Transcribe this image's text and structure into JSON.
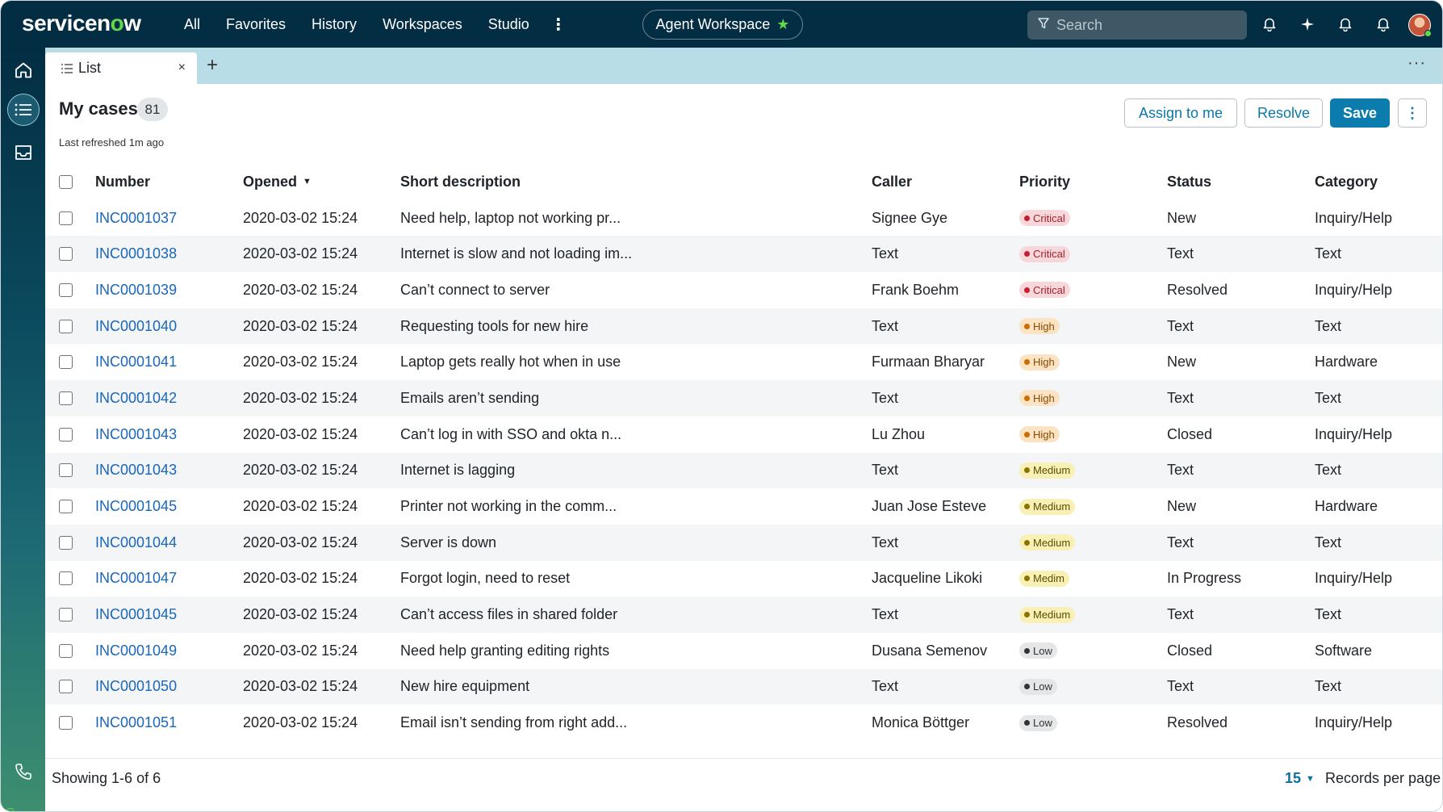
{
  "colors": {
    "nav_bg": "#032d42",
    "accent": "#0b7cad",
    "link": "#1a66b8",
    "brand_green": "#62d84e",
    "tab_bar": "#b9dde6"
  },
  "nav": {
    "logo_prefix": "servicen",
    "logo_o": "o",
    "logo_suffix": "w",
    "links": [
      "All",
      "Favorites",
      "History",
      "Workspaces",
      "Studio"
    ],
    "more": "⋮",
    "workspace": "Agent Workspace",
    "search_placeholder": "Search",
    "icons": [
      "bell-icon",
      "sparkle-icon",
      "notification-icon",
      "alert-icon"
    ]
  },
  "sidebar": {
    "items": [
      "home-icon",
      "list-icon",
      "inbox-icon"
    ],
    "bottom": "phone-icon"
  },
  "tabs": {
    "active_label": "List",
    "close": "×",
    "add": "+",
    "more": "···"
  },
  "header": {
    "title": "My cases",
    "count": "81",
    "refreshed": "Last refreshed 1m ago",
    "buttons": {
      "assign": "Assign to me",
      "resolve": "Resolve",
      "save": "Save",
      "more": "⋮"
    }
  },
  "table": {
    "columns": [
      "Number",
      "Opened",
      "Short description",
      "Caller",
      "Priority",
      "Status",
      "Category"
    ],
    "sort_indicator": "▼",
    "rows": [
      {
        "number": "INC0001037",
        "opened": "2020-03-02 15:24",
        "description": "Need help, laptop not working pr...",
        "caller": "Signee Gye",
        "priority": "Critical",
        "priority_level": "critical",
        "status": "New",
        "category": "Inquiry/Help"
      },
      {
        "number": "INC0001038",
        "opened": "2020-03-02 15:24",
        "description": "Internet is slow and not loading im...",
        "caller": "Text",
        "priority": "Critical",
        "priority_level": "critical",
        "status": "Text",
        "category": "Text"
      },
      {
        "number": "INC0001039",
        "opened": "2020-03-02 15:24",
        "description": "Can’t connect to server",
        "caller": "Frank Boehm",
        "priority": "Critical",
        "priority_level": "critical",
        "status": "Resolved",
        "category": "Inquiry/Help"
      },
      {
        "number": "INC0001040",
        "opened": "2020-03-02 15:24",
        "description": "Requesting tools for new hire",
        "caller": "Text",
        "priority": "High",
        "priority_level": "high",
        "status": "Text",
        "category": "Text"
      },
      {
        "number": "INC0001041",
        "opened": "2020-03-02 15:24",
        "description": "Laptop gets really hot when in use",
        "caller": "Furmaan Bharyar",
        "priority": "High",
        "priority_level": "high",
        "status": "New",
        "category": "Hardware"
      },
      {
        "number": "INC0001042",
        "opened": "2020-03-02 15:24",
        "description": "Emails aren’t sending",
        "caller": "Text",
        "priority": "High",
        "priority_level": "high",
        "status": "Text",
        "category": "Text"
      },
      {
        "number": "INC0001043",
        "opened": "2020-03-02 15:24",
        "description": "Can’t log in with SSO and okta n...",
        "caller": "Lu Zhou",
        "priority": "High",
        "priority_level": "high",
        "status": "Closed",
        "category": "Inquiry/Help"
      },
      {
        "number": "INC0001043",
        "opened": "2020-03-02 15:24",
        "description": "Internet is lagging",
        "caller": "Text",
        "priority": "Medium",
        "priority_level": "medium",
        "status": "Text",
        "category": "Text"
      },
      {
        "number": "INC0001045",
        "opened": "2020-03-02 15:24",
        "description": "Printer not working in the comm...",
        "caller": "Juan Jose Esteve",
        "priority": "Medium",
        "priority_level": "medium",
        "status": "New",
        "category": "Hardware"
      },
      {
        "number": "INC0001044",
        "opened": "2020-03-02 15:24",
        "description": "Server is down",
        "caller": "Text",
        "priority": "Medium",
        "priority_level": "medium",
        "status": "Text",
        "category": "Text"
      },
      {
        "number": "INC0001047",
        "opened": "2020-03-02 15:24",
        "description": "Forgot login, need to reset",
        "caller": "Jacqueline Likoki",
        "priority": "Medim",
        "priority_level": "medium",
        "status": "In Progress",
        "category": "Inquiry/Help"
      },
      {
        "number": "INC0001045",
        "opened": "2020-03-02 15:24",
        "description": "Can’t access files in shared folder",
        "caller": "Text",
        "priority": "Medium",
        "priority_level": "medium",
        "status": "Text",
        "category": "Text"
      },
      {
        "number": "INC0001049",
        "opened": "2020-03-02 15:24",
        "description": "Need help granting editing rights",
        "caller": "Dusana Semenov",
        "priority": "Low",
        "priority_level": "low",
        "status": "Closed",
        "category": "Software"
      },
      {
        "number": "INC0001050",
        "opened": "2020-03-02 15:24",
        "description": "New hire equipment",
        "caller": "Text",
        "priority": "Low",
        "priority_level": "low",
        "status": "Text",
        "category": "Text"
      },
      {
        "number": "INC0001051",
        "opened": "2020-03-02 15:24",
        "description": "Email isn’t sending from right add...",
        "caller": "Monica Böttger",
        "priority": "Low",
        "priority_level": "low",
        "status": "Resolved",
        "category": "Inquiry/Help"
      }
    ]
  },
  "footer": {
    "showing": "Showing 1-6 of 6",
    "per_page_value": "15",
    "per_page_caret": "▼",
    "per_page_label": "Records per page"
  }
}
